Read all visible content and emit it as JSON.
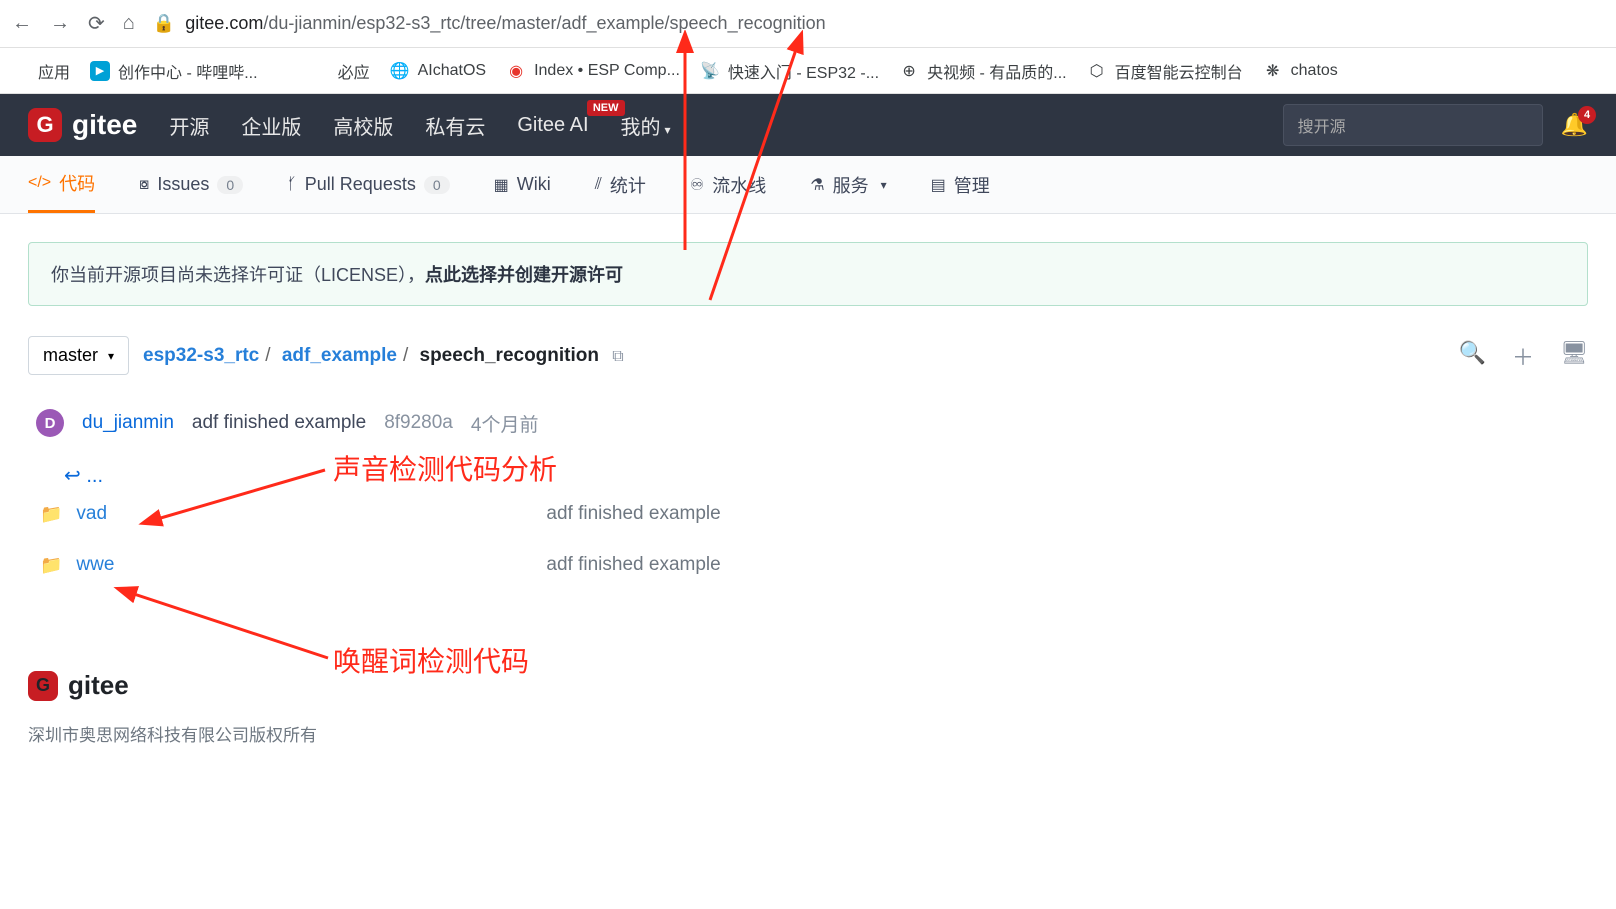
{
  "addressBar": {
    "domain": "gitee.com",
    "path": "/du-jianmin/esp32-s3_rtc/tree/master/adf_example/speech_recognition"
  },
  "bookmarks": {
    "apps": "应用",
    "items": [
      "创作中心 - 哔哩哔...",
      "必应",
      "AIchatOS",
      "Index • ESP Comp...",
      "快速入门 - ESP32 -...",
      "央视频 - 有品质的...",
      "百度智能云控制台",
      "chatos"
    ]
  },
  "topnav": {
    "logo": "gitee",
    "links": [
      "开源",
      "企业版",
      "高校版",
      "私有云"
    ],
    "ai": "Gitee AI",
    "aiBadge": "NEW",
    "mine": "我的",
    "searchPlaceholder": "搜开源",
    "bellCount": "4"
  },
  "tabs": {
    "code": "代码",
    "issues": "Issues",
    "issuesCount": "0",
    "pr": "Pull Requests",
    "prCount": "0",
    "wiki": "Wiki",
    "stats": "统计",
    "pipeline": "流水线",
    "service": "服务",
    "manage": "管理"
  },
  "notice": {
    "pre": "你当前开源项目尚未选择许可证（LICENSE），",
    "bold": "点此选择并创建开源许可"
  },
  "branch": "master",
  "crumb": {
    "repo": "esp32-s3_rtc",
    "dir": "adf_example",
    "cur": "speech_recognition"
  },
  "commit": {
    "user": "du_jianmin",
    "msg": "adf finished example",
    "sha": "8f9280a",
    "time": "4个月前"
  },
  "backRow": "...",
  "files": [
    {
      "name": "vad",
      "msg": "adf finished example"
    },
    {
      "name": "wwe",
      "msg": "adf finished example"
    }
  ],
  "footer": {
    "logo": "gitee",
    "copyright": "深圳市奥思网络科技有限公司版权所有"
  },
  "annotations": {
    "a1": "声音检测代码分析",
    "a2": "唤醒词检测代码"
  }
}
